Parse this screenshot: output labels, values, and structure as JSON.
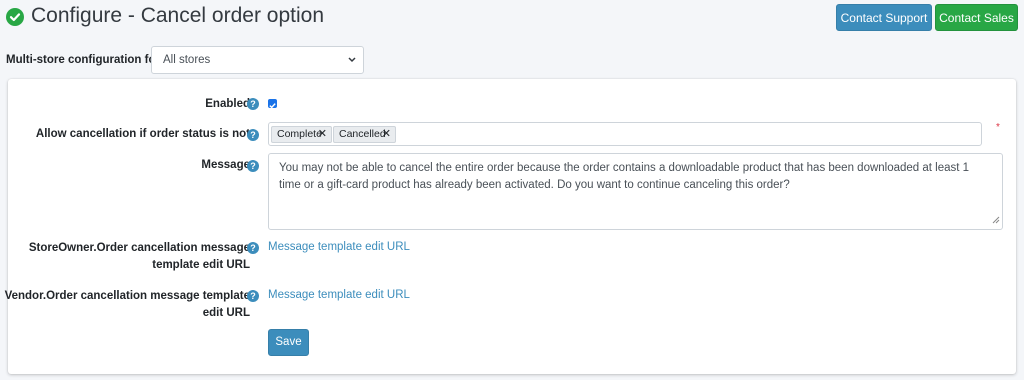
{
  "header": {
    "title": "Configure - Cancel order option",
    "title_icon": "check-circle-icon",
    "support_label": "Contact Support",
    "sales_label": "Contact Sales"
  },
  "store_config": {
    "label": "Multi-store configuration for",
    "selected": "All stores"
  },
  "form": {
    "enabled_label": "Enabled",
    "enabled_checked": true,
    "allow_label": "Allow cancellation if order status is not",
    "tags": [
      "Complete",
      "Cancelled"
    ],
    "required_mark": "*",
    "message_label": "Message",
    "message_value": "You may not be able to cancel the entire order because the order contains a downloadable product that has been downloaded at least 1 time or a gift-card product has already been activated. Do you want to continue canceling this order?",
    "storeowner_label_line1": "StoreOwner.Order cancellation message",
    "storeowner_label_line2": "template edit URL",
    "storeowner_link": "Message template edit URL",
    "vendor_label_line1": "Vendor.Order cancellation message template",
    "vendor_label_line2": "edit URL",
    "vendor_link": "Message template edit URL",
    "save_label": "Save",
    "help_glyph": "?"
  },
  "colors": {
    "primary": "#3c8dbc",
    "success": "#28a745",
    "danger": "#dc3545"
  }
}
